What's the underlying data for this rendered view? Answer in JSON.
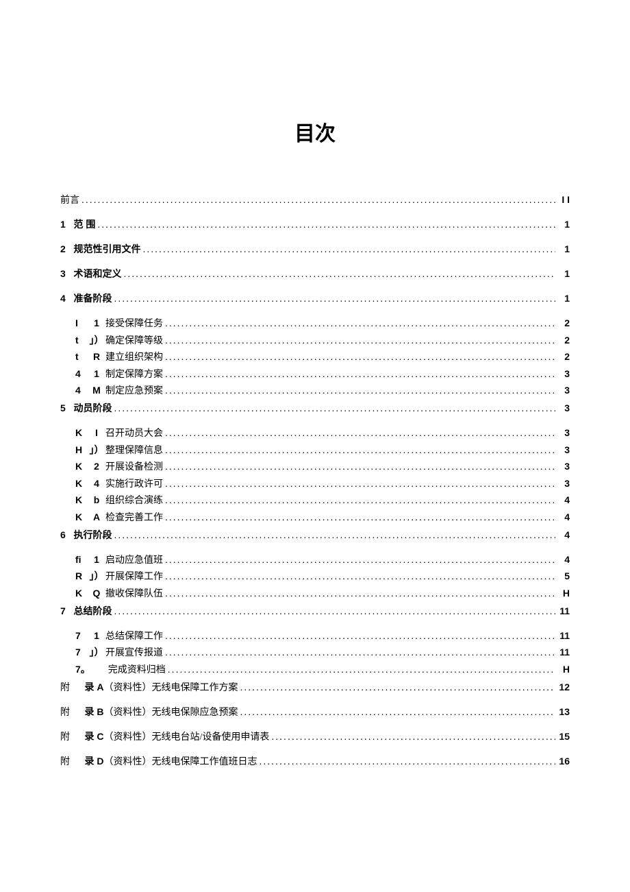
{
  "title": "目次",
  "entries": [
    {
      "kind": "top",
      "marker": "",
      "label": "前言",
      "page": "I I",
      "bold": false
    },
    {
      "kind": "top",
      "marker": "1",
      "label": "范 围",
      "page": "1",
      "bold": true
    },
    {
      "kind": "top",
      "marker": "2",
      "label": "规范性引用文件",
      "page": "1",
      "bold": true
    },
    {
      "kind": "top",
      "marker": "3",
      "label": "术语和定义",
      "page": "1",
      "bold": true
    },
    {
      "kind": "top",
      "marker": "4",
      "label": "准备阶段",
      "page": "1",
      "bold": true
    },
    {
      "kind": "sub",
      "marker": "I",
      "sub": "1",
      "label": "接受保障任务",
      "page": "2"
    },
    {
      "kind": "sub",
      "marker": "t",
      "sub": "」）",
      "label": "确定保障等级",
      "page": "2"
    },
    {
      "kind": "sub",
      "marker": "t",
      "sub": "R",
      "label": "建立组织架构",
      "page": "2"
    },
    {
      "kind": "sub",
      "marker": "4",
      "sub": "1",
      "label": "制定保障方案",
      "page": "3"
    },
    {
      "kind": "sub",
      "marker": "4",
      "sub": "M",
      "label": "制定应急预案",
      "page": "3"
    },
    {
      "kind": "top",
      "marker": "5",
      "label": "动员阶段",
      "page": "3",
      "bold": true,
      "gap": true
    },
    {
      "kind": "sub",
      "marker": "K",
      "sub": "I",
      "label": "召开动员大会",
      "page": "3"
    },
    {
      "kind": "sub",
      "marker": "H",
      "sub": "」）",
      "label": "整理保障信息",
      "page": "3"
    },
    {
      "kind": "sub",
      "marker": "K",
      "sub": "2",
      "label": "开展设备检测",
      "page": "3"
    },
    {
      "kind": "sub",
      "marker": "K",
      "sub": "4",
      "label": "实施行政许可",
      "page": "3"
    },
    {
      "kind": "sub",
      "marker": "K",
      "sub": "b",
      "label": "组织综合演练",
      "page": "4"
    },
    {
      "kind": "sub",
      "marker": "K",
      "sub": "A",
      "label": "检查完善工作",
      "page": "4"
    },
    {
      "kind": "top",
      "marker": "6",
      "label": "执行阶段",
      "page": "4",
      "bold": true,
      "gap": true
    },
    {
      "kind": "sub",
      "marker": "fi",
      "sub": "1",
      "label": "启动应急值班",
      "page": "4"
    },
    {
      "kind": "sub",
      "marker": "R",
      "sub": "」）",
      "label": "开展保障工作",
      "page": "5"
    },
    {
      "kind": "sub",
      "marker": "K",
      "sub": "Q",
      "label": "撤收保障队伍",
      "page": "H"
    },
    {
      "kind": "top",
      "marker": "7",
      "label": "总结阶段",
      "page": "11",
      "bold": true,
      "gap": true
    },
    {
      "kind": "sub",
      "marker": "7",
      "sub": "1",
      "label": "总结保障工作",
      "page": "11"
    },
    {
      "kind": "sub",
      "marker": "7",
      "sub": "」）",
      "label": "开展宣传报道",
      "page": "11"
    },
    {
      "kind": "sub",
      "marker": "7。",
      "sub": "",
      "label": "完成资料归档",
      "page": "H"
    },
    {
      "kind": "appendix",
      "marker": "附",
      "sub": "录 A",
      "label": "（资料性）无线电保障工作方案",
      "page": "12",
      "gap": true
    },
    {
      "kind": "appendix",
      "marker": "附",
      "sub": "录 B",
      "label": "（资料性）无线电保隙应急预案",
      "page": "13"
    },
    {
      "kind": "appendix",
      "marker": "附",
      "sub": "录 C",
      "label": "（资料性）无线电台站/设备使用申请表",
      "page": "15"
    },
    {
      "kind": "appendix",
      "marker": "附",
      "sub": "录 D",
      "label": "（资料性）无线电保障工作值班日志",
      "page": "16"
    }
  ]
}
